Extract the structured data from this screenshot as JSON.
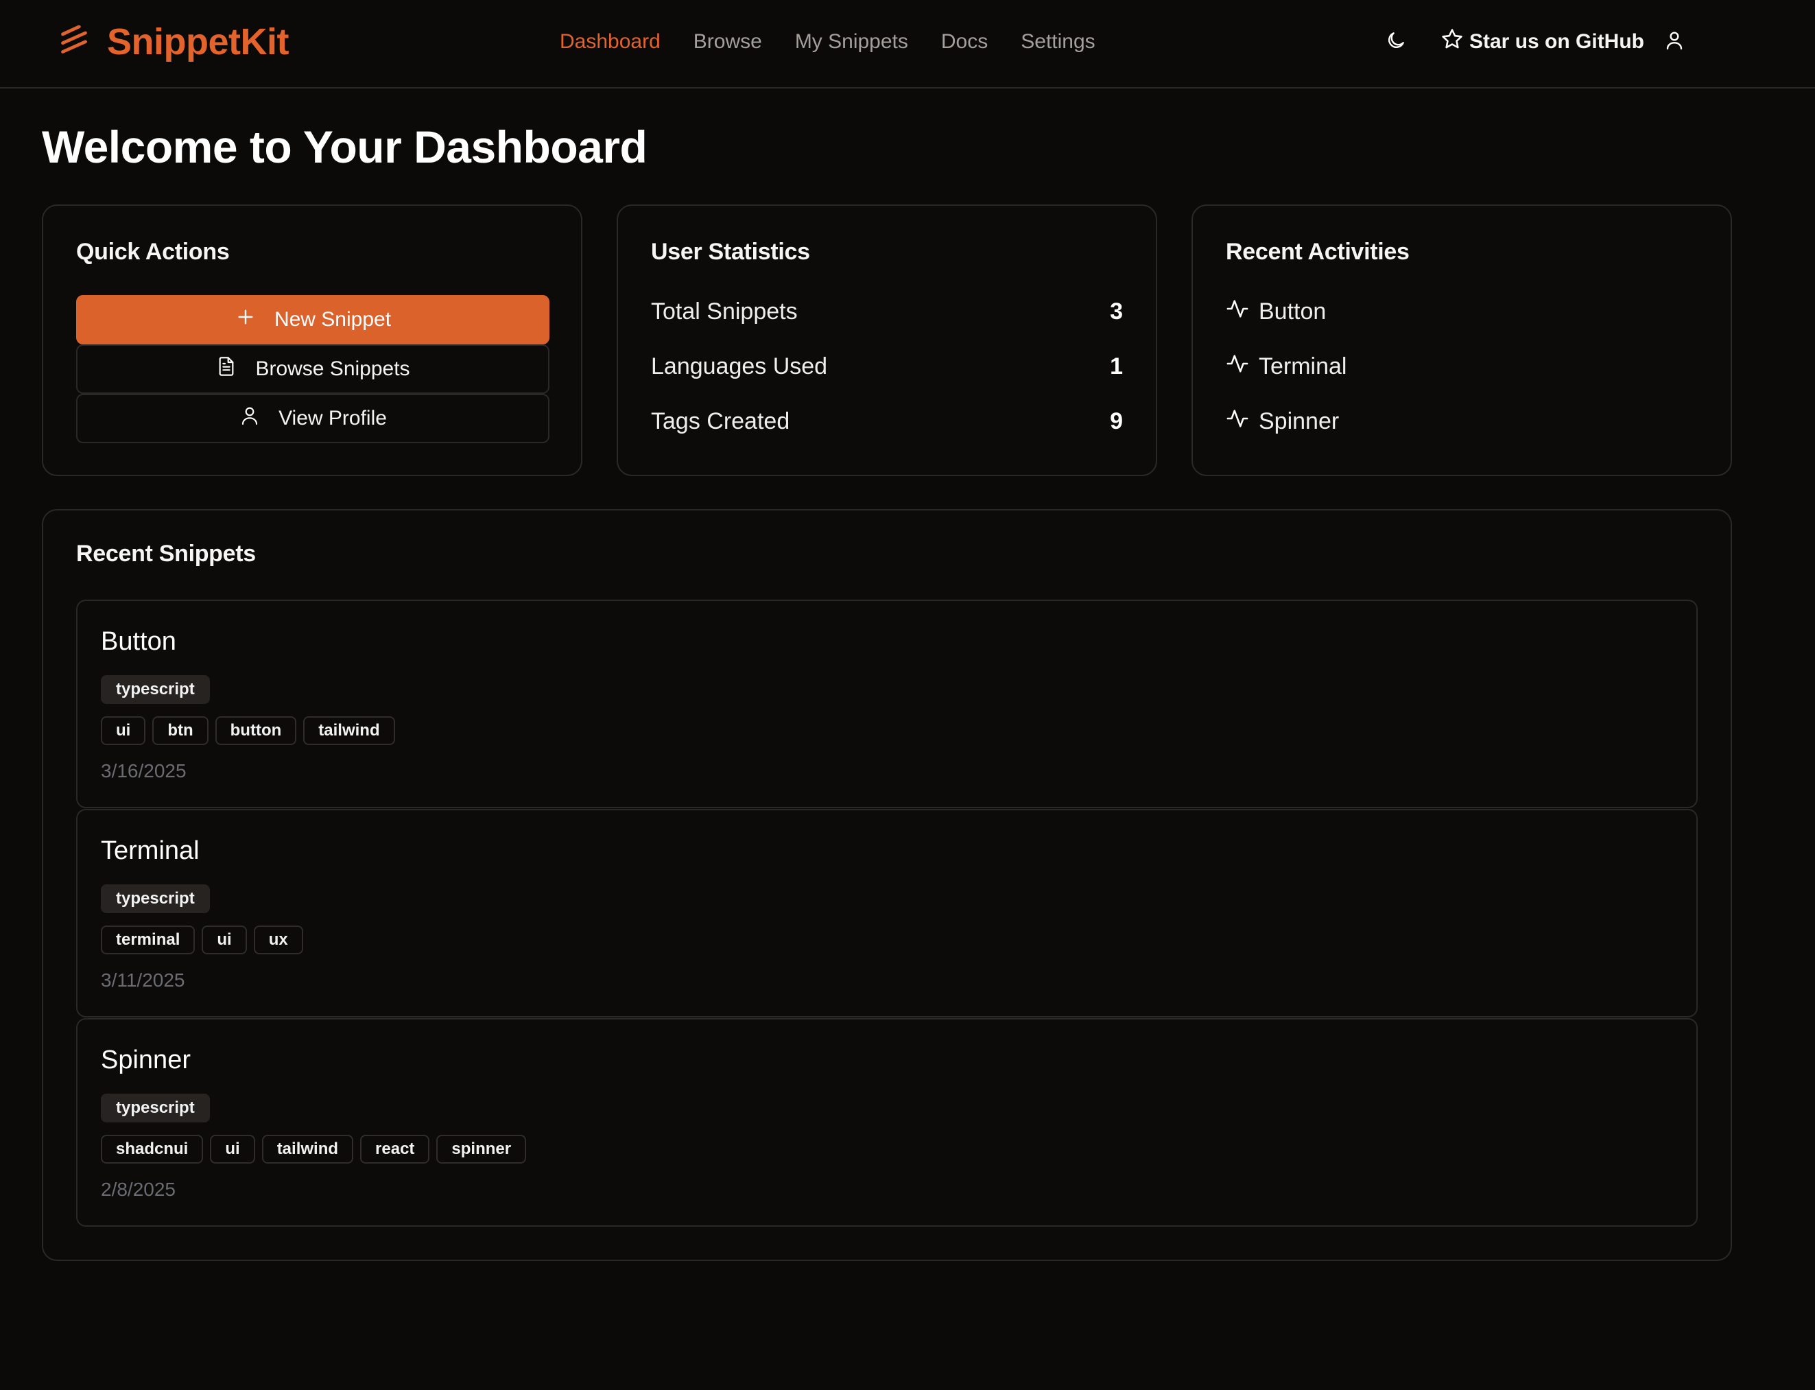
{
  "header": {
    "brand": "SnippetKit",
    "nav": [
      "Dashboard",
      "Browse",
      "My Snippets",
      "Docs",
      "Settings"
    ],
    "active_nav": "Dashboard",
    "github_label": "Star us on GitHub"
  },
  "page_title": "Welcome to Your Dashboard",
  "quick_actions": {
    "title": "Quick Actions",
    "new_snippet": "New Snippet",
    "browse_snippets": "Browse Snippets",
    "view_profile": "View Profile"
  },
  "user_statistics": {
    "title": "User Statistics",
    "rows": [
      {
        "label": "Total Snippets",
        "value": "3"
      },
      {
        "label": "Languages Used",
        "value": "1"
      },
      {
        "label": "Tags Created",
        "value": "9"
      }
    ]
  },
  "recent_activities": {
    "title": "Recent Activities",
    "items": [
      "Button",
      "Terminal",
      "Spinner"
    ]
  },
  "recent_snippets": {
    "title": "Recent Snippets",
    "items": [
      {
        "title": "Button",
        "language": "typescript",
        "tags": [
          "ui",
          "btn",
          "button",
          "tailwind"
        ],
        "date": "3/16/2025"
      },
      {
        "title": "Terminal",
        "language": "typescript",
        "tags": [
          "terminal",
          "ui",
          "ux"
        ],
        "date": "3/11/2025"
      },
      {
        "title": "Spinner",
        "language": "typescript",
        "tags": [
          "shadcnui",
          "ui",
          "tailwind",
          "react",
          "spinner"
        ],
        "date": "2/8/2025"
      }
    ]
  },
  "colors": {
    "accent": "#e2632b",
    "background": "#0b0a09",
    "border": "#2b2927",
    "muted_date": "#6b6c72"
  },
  "icons": {
    "brand": "layers-stripes-icon",
    "theme": "moon-icon",
    "github": "star-icon",
    "user": "user-icon",
    "activity": "activity-pulse-icon"
  }
}
